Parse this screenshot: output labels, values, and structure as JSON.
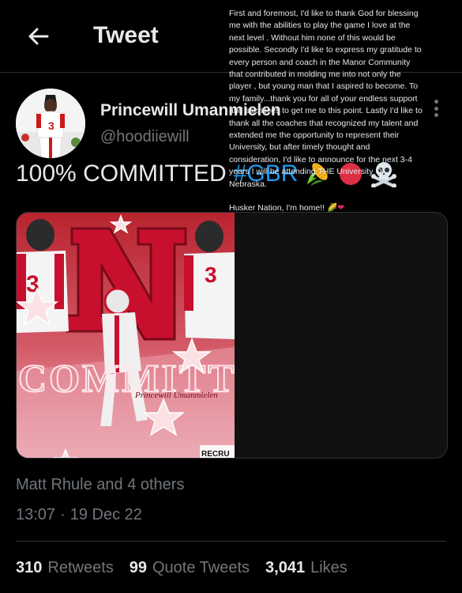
{
  "header": {
    "title": "Tweet",
    "back_icon": "arrow-left-icon"
  },
  "author": {
    "display_name": "Princewill Umanmielen",
    "handle": "@hoodiiewill"
  },
  "tweet": {
    "text_main": "100% COMMITTED",
    "hashtag": "#GBR",
    "emojis": [
      "corn-icon",
      "red-circle-icon",
      "skull-crossbones-icon"
    ]
  },
  "media": {
    "graphic_word": "COMMITTED",
    "watermark": "RECRU",
    "signature": "Princewill Umanmielen",
    "letter_paragraph_1": "First and foremost, I'd like to thank God for blessing me with the abilities to play the game I love at the next level . Without him none of this would be possible. Secondly I'd like to express my gratitude to every person and coach in the Manor Community  that contributed in molding me into not only the player , but young man that I aspired to become. To my family...thank you for all of your endless support and sacrifices to get me to this point. Lastly I'd like to thank all the coaches that recognized my talent and extended me the opportunity to represent their University, but after timely thought and consideration, I'd like to announce for the next 3-4 years I will be attending THE University Of Nebraska.",
    "letter_paragraph_2": "Husker Nation, I'm home!!"
  },
  "meta": {
    "liked_by": "Matt Rhule and 4 others",
    "time": "13:07",
    "separator": "·",
    "date": "19 Dec 22"
  },
  "stats": {
    "retweets_count": "310",
    "retweets_label": "Retweets",
    "quotes_count": "99",
    "quotes_label": "Quote Tweets",
    "likes_count": "3,041",
    "likes_label": "Likes"
  },
  "colors": {
    "background": "#000000",
    "text": "#e7e9ea",
    "secondary": "#71767b",
    "link": "#1d9bf0",
    "nebraska_red": "#d00000"
  }
}
